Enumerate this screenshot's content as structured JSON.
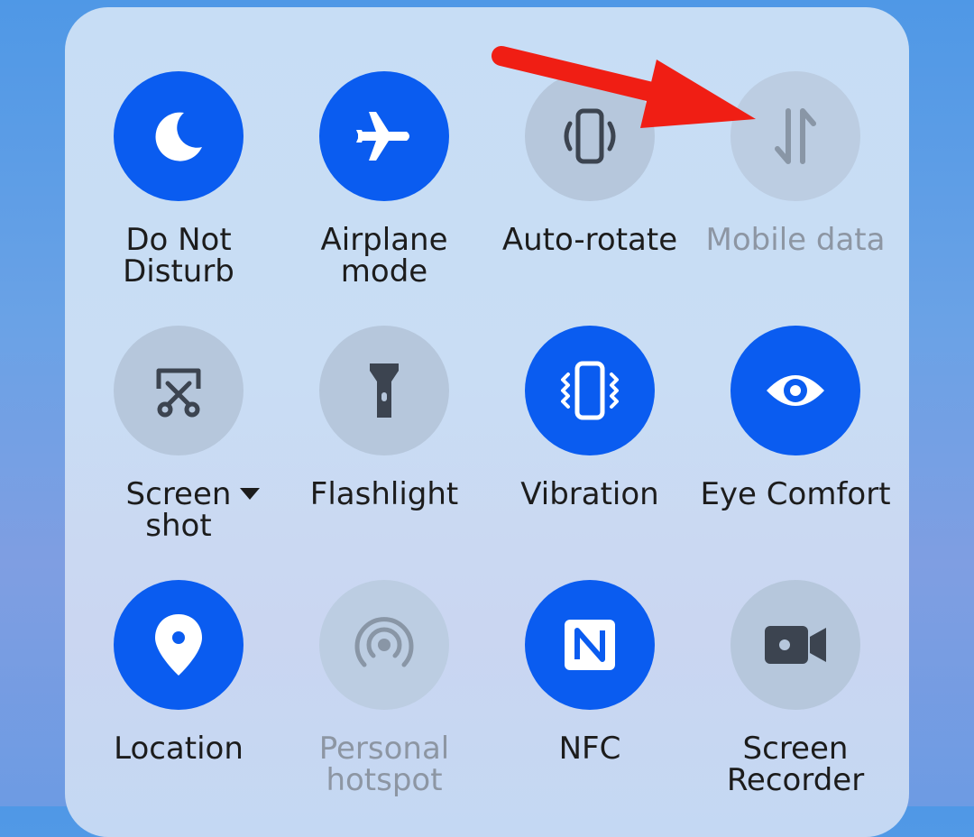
{
  "quick_settings": {
    "row1": [
      {
        "label": "Do Not\nDisturb",
        "icon": "moon-icon",
        "state": "on"
      },
      {
        "label": "Airplane\nmode",
        "icon": "airplane-icon",
        "state": "on"
      },
      {
        "label": "Auto-rotate",
        "icon": "auto-rotate-icon",
        "state": "off"
      },
      {
        "label": "Mobile data",
        "icon": "mobile-data-icon",
        "state": "disabled"
      }
    ],
    "row2": [
      {
        "label": "Screen\nshot",
        "icon": "screenshot-scissors-icon",
        "state": "off"
      },
      {
        "label": "Flashlight",
        "icon": "flashlight-icon",
        "state": "off"
      },
      {
        "label": "Vibration",
        "icon": "vibration-icon",
        "state": "on"
      },
      {
        "label": "Eye Comfort",
        "icon": "eye-icon",
        "state": "on"
      }
    ],
    "row3": [
      {
        "label": "Location",
        "icon": "location-pin-icon",
        "state": "on"
      },
      {
        "label": "Personal\nhotspot",
        "icon": "hotspot-icon",
        "state": "disabled"
      },
      {
        "label": "NFC",
        "icon": "nfc-icon",
        "state": "on"
      },
      {
        "label": "Screen\nRecorder",
        "icon": "video-camera-icon",
        "state": "off"
      }
    ]
  },
  "colors": {
    "active": "#0a5cf0",
    "inactive": "#b6c7dc",
    "icon_inactive": "#3c4450",
    "annotation_arrow": "#f01e14"
  }
}
